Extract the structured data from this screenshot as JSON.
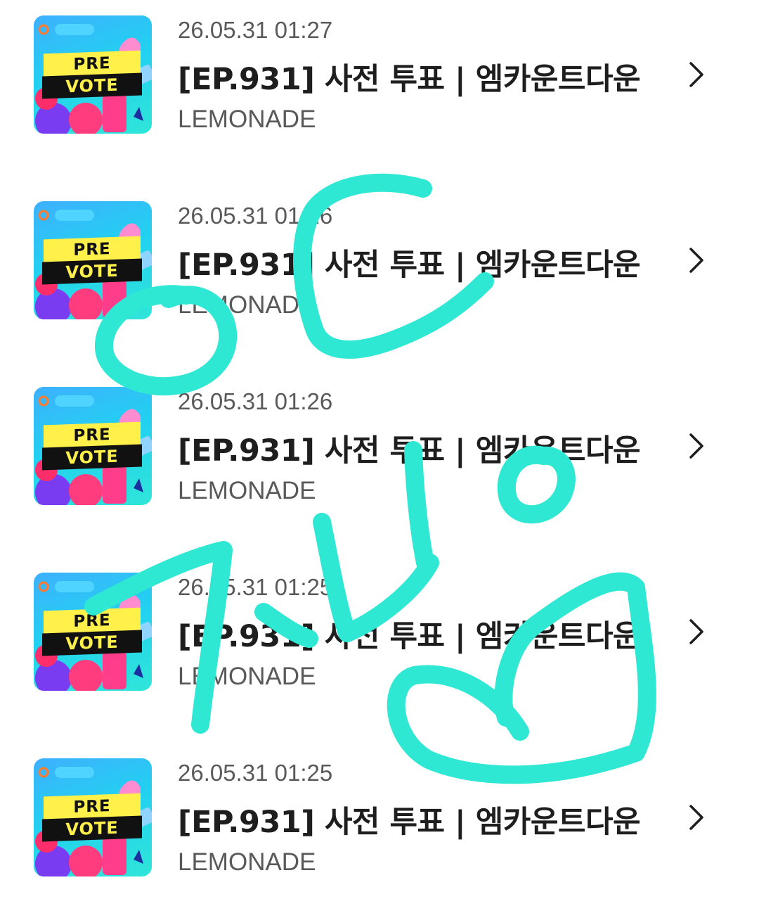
{
  "items": [
    {
      "date": "26.05.31 01:27",
      "title": "[EP.931] 사전 투표 | 엠카운트다운",
      "artist": "LEMONADE",
      "thumb_top": "PRE",
      "thumb_bottom": "VOTE"
    },
    {
      "date": "26.05.31 01:26",
      "title": "[EP.931] 사전 투표 | 엠카운트다운",
      "artist": "LEMONADE",
      "thumb_top": "PRE",
      "thumb_bottom": "VOTE"
    },
    {
      "date": "26.05.31 01:26",
      "title": "[EP.931] 사전 투표 | 엠카운트다운",
      "artist": "LEMONADE",
      "thumb_top": "PRE",
      "thumb_bottom": "VOTE"
    },
    {
      "date": "26.05.31 01:25",
      "title": "[EP.931] 사전 투표 | 엠카운트다운",
      "artist": "LEMONADE",
      "thumb_top": "PRE",
      "thumb_bottom": "VOTE"
    },
    {
      "date": "26.05.31 01:25",
      "title": "[EP.931] 사전 투표 | 엠카운트다운",
      "artist": "LEMONADE",
      "thumb_top": "PRE",
      "thumb_bottom": "VOTE"
    }
  ],
  "icons": {
    "chevron": "chevron-right-icon"
  },
  "colors": {
    "scribble": "#2ee8d4",
    "title": "#1e1e1e",
    "meta": "#595959"
  }
}
